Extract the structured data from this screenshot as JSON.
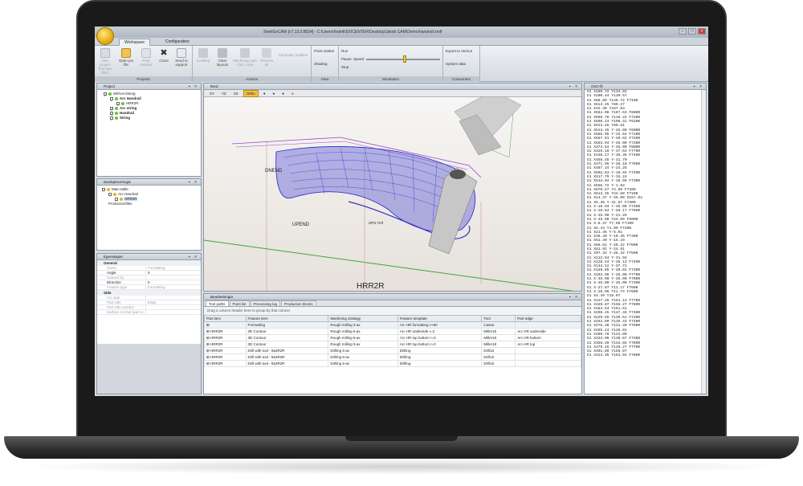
{
  "window": {
    "title": "SteelGoCAM [v7.13.0.8034] - C:\\Users\\fredrik\\DOCENTER\\Desktop\\Jakob CAM\\Demo\\handrail.xmlf"
  },
  "ribbon_tabs": [
    "Workspace",
    "Configuration"
  ],
  "ribbon": {
    "projects": {
      "label": "Projects",
      "buttons": [
        "New project from prx files",
        "Open prx file",
        "Print preview",
        "Close",
        "Send to support"
      ]
    },
    "actions": {
      "label": "Actions",
      "buttons": [
        "Leveling",
        "Clear layouts",
        "Machining with CNC code",
        "Process all",
        "Automatic position"
      ]
    },
    "view": {
      "label": "View",
      "items": [
        "Point marker",
        "Shading"
      ]
    },
    "simulation": {
      "label": "Simulation",
      "items": [
        "Run",
        "Pause",
        "Stop"
      ],
      "speed_label": "Speed"
    },
    "consumers": {
      "label": "Consumers",
      "items": [
        "Export to Vericut",
        "System data"
      ]
    }
  },
  "project_panel": {
    "title": "Project",
    "tree": [
      {
        "label": "WithArcString",
        "bold": false,
        "indent": 0
      },
      {
        "label": "Arc Handrail",
        "bold": true,
        "indent": 1
      },
      {
        "label": "HRR2R",
        "bold": false,
        "indent": 2
      },
      {
        "label": "Arc string",
        "bold": true,
        "indent": 1
      },
      {
        "label": "Handrail",
        "bold": true,
        "indent": 1
      },
      {
        "label": "String",
        "bold": true,
        "indent": 1
      }
    ]
  },
  "layout_panel": {
    "title": "Bordsplaceringar",
    "tree": [
      {
        "label": "Main table",
        "indent": 0
      },
      {
        "label": "Arc Handrail",
        "indent": 1
      },
      {
        "label": "HRR2R",
        "indent": 2
      },
      {
        "label": "Productionfiles",
        "indent": 1
      }
    ]
  },
  "properties_panel": {
    "title": "Egenskaper",
    "sections": [
      {
        "name": "General",
        "rows": [
          {
            "k": "Name",
            "v": "Formatting",
            "dim": true
          },
          {
            "k": "Angle",
            "v": "0",
            "dim": false
          },
          {
            "k": "Caused by",
            "v": "",
            "dim": true
          },
          {
            "k": "Direction",
            "v": "0",
            "dim": false
          },
          {
            "k": "Feature type",
            "v": "Formatting",
            "dim": true
          }
        ]
      },
      {
        "name": "Side",
        "rows": [
          {
            "k": "Arc side",
            "v": "",
            "dim": true
          },
          {
            "k": "Part side",
            "v": "Edge",
            "dim": true
          },
          {
            "k": "Part side number",
            "v": "",
            "dim": true
          },
          {
            "k": "Surface normal (part si",
            "v": "",
            "dim": true
          }
        ]
      }
    ]
  },
  "viewport": {
    "title": "Bord",
    "view_buttons": [
      "XY",
      "YZ",
      "XZ",
      "Ortho"
    ],
    "active_view": "Ortho",
    "labels": {
      "part": "HRR2R",
      "end": "DNEND",
      "start": "UPEND",
      "mid": "UPS.7mf"
    }
  },
  "operations_panel": {
    "title": "Bearbetningar",
    "tabs": [
      "Tool paths",
      "Point list",
      "Processing log",
      "Production blocks"
    ],
    "group_hint": "Drag a column header here to group by that column",
    "columns": [
      "Part item",
      "Feature item",
      "Machining strategy",
      "Feature template",
      "Tool",
      "Part edge"
    ],
    "rows": [
      [
        "",
        "Formatting",
        "Rough milling 3-ax",
        "Arc HR formatting z+50",
        "Castor",
        ""
      ],
      [
        "HRR2R",
        "3D Contour",
        "Rough milling 5-ax",
        "Arc HR underside r=2",
        "Miller18",
        "Arc HR underside"
      ],
      [
        "HRR2R",
        "3D Contour",
        "Rough milling 5-ax",
        "Arc HR top bottom r=0",
        "Miller18",
        "Arc HR bottom"
      ],
      [
        "HRR2R",
        "3D Contour",
        "Rough milling 5-ax",
        "Arc HR top bottom r=0",
        "Miller18",
        "Arc HR top"
      ],
      [
        "HRR2R",
        "Drill with tool - 8a3R2R",
        "Drilling 5-ax",
        "Drilling",
        "Drill15",
        ""
      ],
      [
        "HRR2R",
        "Drill with tool - 8a3R2R",
        "Drilling 5-ax",
        "Drilling",
        "Drill15",
        ""
      ],
      [
        "HRR2R",
        "Drill with tool - 8a3R2R",
        "Drilling 5-ax",
        "Drilling",
        "Drill15",
        ""
      ]
    ]
  },
  "nc_panel": {
    "title": "CNC-fil",
    "lines": [
      "G1 X105.72 Y134.82",
      "G1 X100.44 Y139.57",
      "G1 X88.89 Y146.72 F7100",
      "G1 X613.45 Y80.27",
      "G1 X42.30 Y167.63",
      "G1 X564.06 Y167.63 F8000",
      "G1 X596.78 Y110.22 F7200",
      "G1 X598.23 Y106.41 F6100",
      "G1 X613.45 Y60.61",
      "G1 X613.45 Y-25.00 F6000",
      "G1 X585.05 Y-32.64 F7100",
      "G1 X567.91 Y-39.62 F7200",
      "G1 X553.94 Y-45.00 F7300",
      "G1 X373.64 Y-45.00 F8000",
      "G1 X425.19 Y-37.63 F7700",
      "G1 X436.17 Y-35.36 F7400",
      "G1 X456.45 Y-31.70",
      "G1 X471.95 Y-28.18 F7500",
      "G1 X487.34 Y-24.25",
      "G1 X502.63 Y-19.94 F7400",
      "G1 X517.79 Y-15.24",
      "G1 X533.04 Y-10.09 F7300",
      "G1 X555.72 Y-1.63",
      "G1 X570.57 Y4.69 F7200",
      "G1 X613.45 Y24.50 F7100",
      "G1 X14.37 Y-45.00 Z157.04",
      "G1 X5.36 Y-41.67 F7300",
      "G1 X-10.94 Y-35.09 F7400",
      "G1 X-26.64 Y-28.17 F7500",
      "G1 X-45.00 Y-21.29",
      "G1 X-45.00 Y24.69 F6000",
      "G1 X-8.37 Y7.50 F7100",
      "G1 X6.43 Y1.00 F7200",
      "G1 X21.46 Y-5.01",
      "G1 X36.40 Y-10.45 F7400",
      "G1 X51.40 Y-15.19",
      "G1 X66.62 Y-20.22 F7600",
      "G1 X81.92 Y-24.51",
      "G1 X97.33 Y-28.42 F7500",
      "G1 X112.84 Y-31.94",
      "G1 X128.44 Y-35.13 F7400",
      "G1 X144.12 Y-37.71",
      "G1 X159.85 Y-40.01 F7300",
      "G1 X193.98 Y-45.00 F7700",
      "G1 X-45.00 Y-45.00 F7600",
      "G1 X-45.00 Y-45.00 F7300",
      "G1 X-27.87 Y11.17 F7600",
      "G1 X-26.05 Y11.74 F7600",
      "G1 X4.49 Y16.97",
      "G1 X137.29 Y151.12 F7700",
      "G1 X169.87 Y158.27 F7800",
      "G1 X183.54 Y151.51",
      "G1 X206.45 Y147.45 F7400",
      "G1 X229.55 Y139.61 F7200",
      "G1 X252.80 Y135.43 F7400",
      "G1 X276.36 Y131.40 F7500",
      "G1 X285.24 Y129.01",
      "G1 X309.78 Y134.80",
      "G1 X333.06 Y138.67 F7300",
      "G1 X356.20 Y134.65 F7600",
      "G1 X379.15 Y149.27 F7700",
      "G1 X401.89 Y156.87",
      "G1 X424.35 Y164.94 F7800"
    ]
  }
}
